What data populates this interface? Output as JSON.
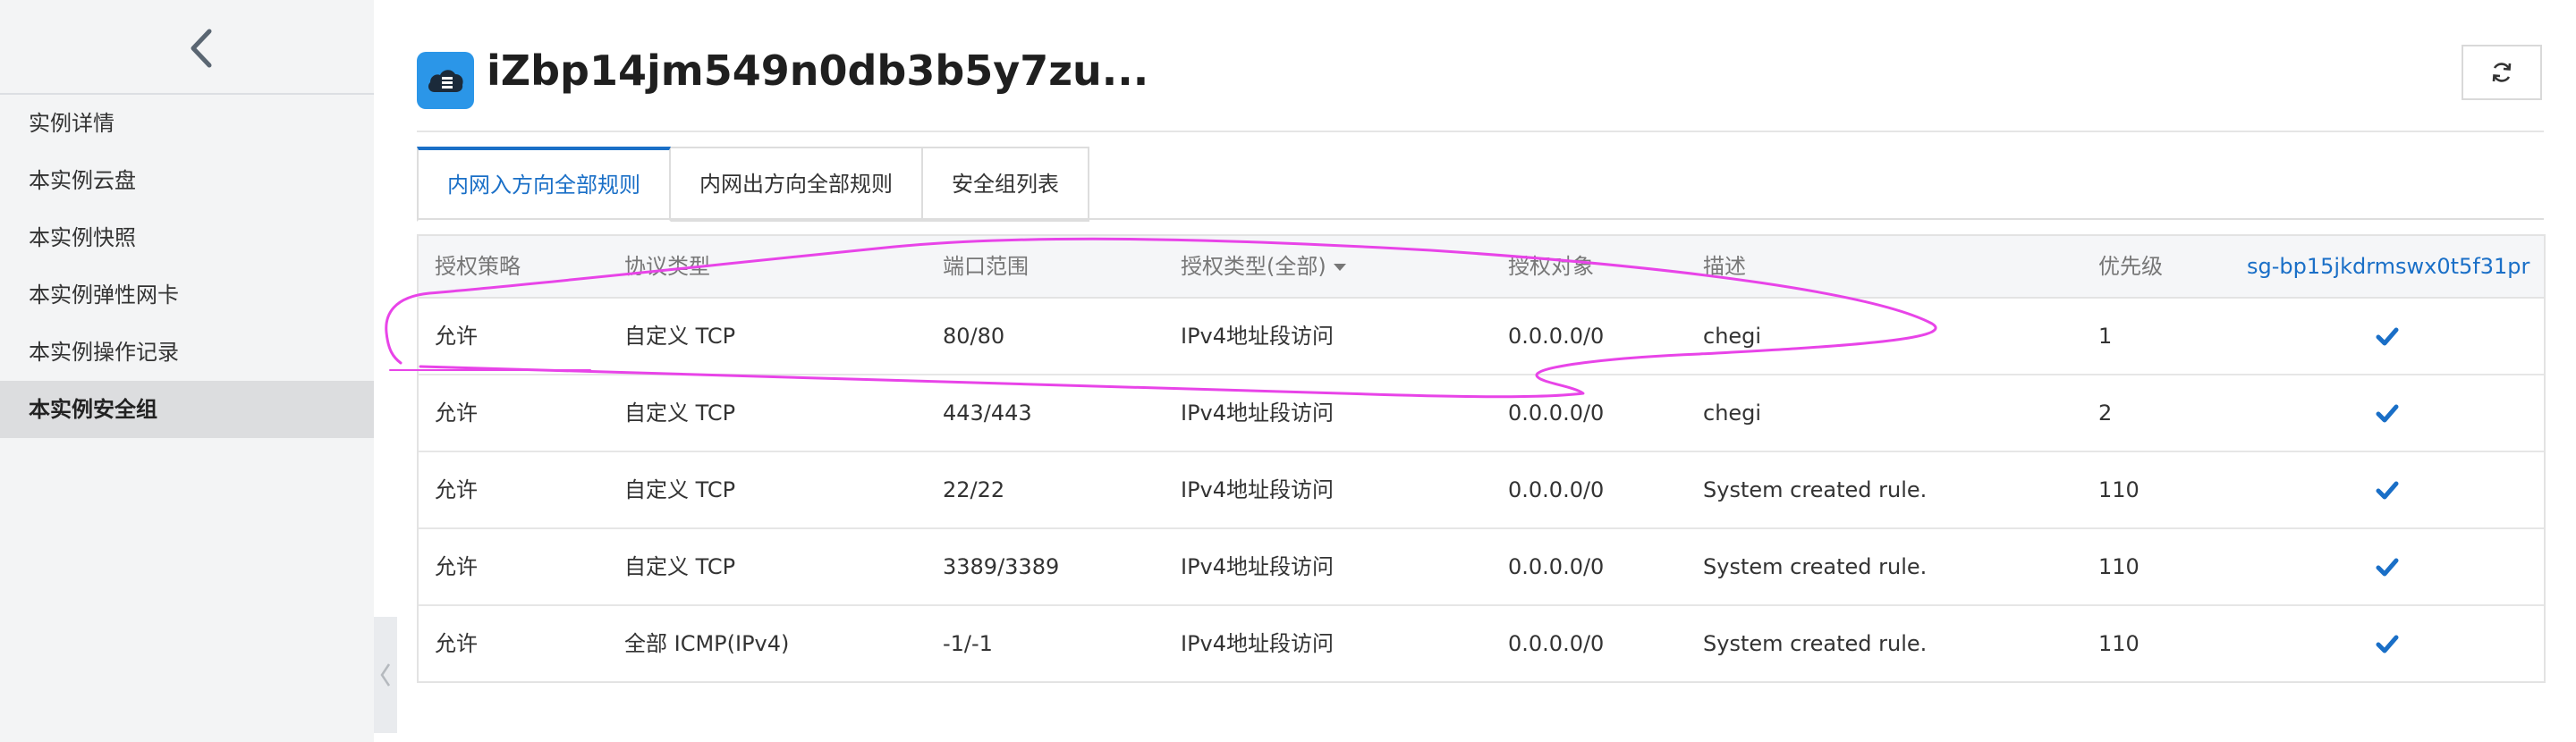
{
  "sidebar": {
    "back_icon": "chevron-left-icon",
    "items": [
      {
        "label": "实例详情"
      },
      {
        "label": "本实例云盘"
      },
      {
        "label": "本实例快照"
      },
      {
        "label": "本实例弹性网卡"
      },
      {
        "label": "本实例操作记录"
      },
      {
        "label": "本实例安全组"
      }
    ],
    "active_index": 5
  },
  "header": {
    "title": "iZbp14jm549n0db3b5y7zu...",
    "icon": "cloud-server-icon",
    "refresh_icon": "refresh-icon"
  },
  "tabs": [
    {
      "label": "内网入方向全部规则"
    },
    {
      "label": "内网出方向全部规则"
    },
    {
      "label": "安全组列表"
    }
  ],
  "active_tab": 0,
  "table": {
    "columns": [
      "授权策略",
      "协议类型",
      "端口范围",
      "授权类型(全部)",
      "授权对象",
      "描述",
      "优先级",
      "sg-bp15jkdrmswx0t5f31pr"
    ],
    "rows": [
      {
        "policy": "允许",
        "protocol": "自定义 TCP",
        "port": "80/80",
        "auth_type": "IPv4地址段访问",
        "object": "0.0.0.0/0",
        "desc": "chegi",
        "priority": "1",
        "checked": true
      },
      {
        "policy": "允许",
        "protocol": "自定义 TCP",
        "port": "443/443",
        "auth_type": "IPv4地址段访问",
        "object": "0.0.0.0/0",
        "desc": "chegi",
        "priority": "2",
        "checked": true
      },
      {
        "policy": "允许",
        "protocol": "自定义 TCP",
        "port": "22/22",
        "auth_type": "IPv4地址段访问",
        "object": "0.0.0.0/0",
        "desc": "System created rule.",
        "priority": "110",
        "checked": true
      },
      {
        "policy": "允许",
        "protocol": "自定义 TCP",
        "port": "3389/3389",
        "auth_type": "IPv4地址段访问",
        "object": "0.0.0.0/0",
        "desc": "System created rule.",
        "priority": "110",
        "checked": true
      },
      {
        "policy": "允许",
        "protocol": "全部 ICMP(IPv4)",
        "port": "-1/-1",
        "auth_type": "IPv4地址段访问",
        "object": "0.0.0.0/0",
        "desc": "System created rule.",
        "priority": "110",
        "checked": true
      }
    ]
  },
  "colors": {
    "accent": "#1a6fc7",
    "check": "#1a6fc7",
    "annotation": "#e844e8",
    "icon_bg": "#2b96e8"
  }
}
